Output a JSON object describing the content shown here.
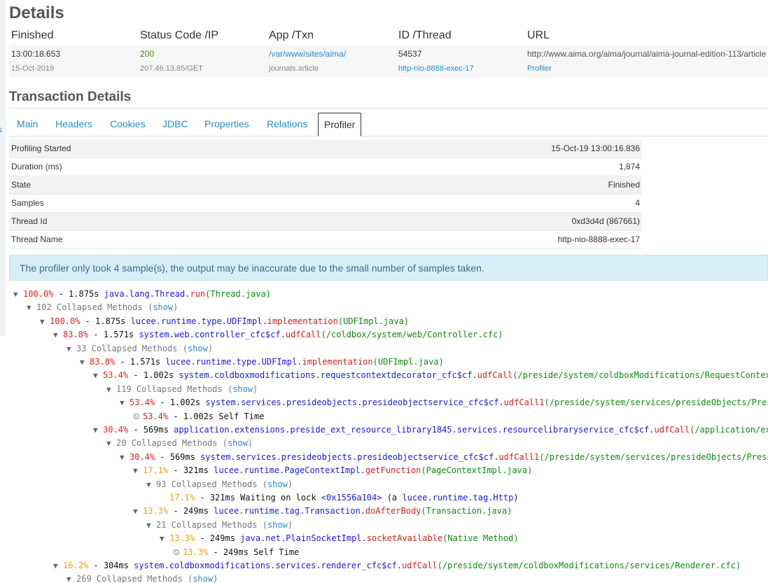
{
  "details": {
    "title": "Details",
    "headers": [
      "Finished",
      "Status Code /IP",
      "App /Txn",
      "ID /Thread",
      "URL"
    ],
    "finished_time": "13:00:18.653",
    "finished_date": "15-Oct-2019",
    "status_code": "200",
    "ip": "207.46.13.85/GET",
    "app": "/var/www/sites/aima/",
    "txn": "journals.article",
    "id": "54537",
    "thread": "http-nio-8888-exec-17",
    "url": "http://www.aima.org/aima/journal/aima-journal-edition-113/article",
    "url_sub": "Profiler"
  },
  "sidebar_fragment": "s",
  "transaction": {
    "title": "Transaction Details",
    "tabs": [
      "Main",
      "Headers",
      "Cookies",
      "JDBC",
      "Properties",
      "Relations",
      "Profiler"
    ],
    "active_tab": "Profiler"
  },
  "profile": {
    "rows": [
      {
        "label": "Profiling Started",
        "value": "15-Oct-19 13:00:16.836"
      },
      {
        "label": "Duration (ms)",
        "value": "1,874"
      },
      {
        "label": "State",
        "value": "Finished"
      },
      {
        "label": "Samples",
        "value": "4"
      },
      {
        "label": "Thread Id",
        "value": "0xd3d4d (867661)"
      },
      {
        "label": "Thread Name",
        "value": "http-nio-8888-exec-17"
      }
    ]
  },
  "alert": "The profiler only took 4 sample(s), the output may be inaccurate due to the small number of samples taken.",
  "tree": [
    {
      "t": "call",
      "d": 0,
      "pct": "100.0%",
      "time": "1.875s",
      "cls": "java.lang.Thread.",
      "method": "run",
      "src": "(Thread.java)"
    },
    {
      "t": "coll",
      "d": 1,
      "text": "102 Collapsed Methods",
      "show": "show"
    },
    {
      "t": "call",
      "d": 2,
      "pct": "100.0%",
      "time": "1.875s",
      "cls": "lucee.runtime.type.UDFImpl.",
      "method": "implementation",
      "src": "(UDFImpl.java)"
    },
    {
      "t": "call",
      "d": 3,
      "pct": "83.8%",
      "time": "1.571s",
      "cls": "system.web.controller_cfc$cf.",
      "method": "udfCall",
      "src": "(/coldbox/system/web/Controller.cfc)"
    },
    {
      "t": "coll",
      "d": 4,
      "text": "33 Collapsed Methods",
      "show": "show"
    },
    {
      "t": "call",
      "d": 5,
      "pct": "83.8%",
      "time": "1.571s",
      "cls": "lucee.runtime.type.UDFImpl.",
      "method": "implementation",
      "src": "(UDFImpl.java)"
    },
    {
      "t": "call",
      "d": 6,
      "pct": "53.4%",
      "time": "1.002s",
      "cls": "system.coldboxmodifications.requestcontextdecorator_cfc$cf.",
      "method": "udfCall",
      "src": "(/preside/system/coldboxModifications/RequestContextDecorator.cfc)"
    },
    {
      "t": "coll",
      "d": 7,
      "text": "119 Collapsed Methods",
      "show": "show"
    },
    {
      "t": "call",
      "d": 8,
      "pct": "53.4%",
      "time": "1.002s",
      "cls": "system.services.presideobjects.presideobjectservice_cfc$cf.",
      "method": "udfCall1",
      "src": "(/preside/system/services/presideObjects/PresideObjectService.cfc)"
    },
    {
      "t": "self",
      "d": 9,
      "pct": "53.4%",
      "time": "1.002s",
      "text": "Self Time"
    },
    {
      "t": "call",
      "d": 6,
      "pct": "30.4%",
      "time": "569ms",
      "cls": "application.extensions.preside_ext_resource_library1845.services.resourcelibraryservice_cfc$cf.",
      "method": "udfCall",
      "src": "(/application/extensions/preside-ext-resource-library/services/ResourceLibraryService.cfc)"
    },
    {
      "t": "coll",
      "d": 7,
      "text": "20 Collapsed Methods",
      "show": "show"
    },
    {
      "t": "call",
      "d": 8,
      "pct": "30.4%",
      "time": "569ms",
      "cls": "system.services.presideobjects.presideobjectservice_cfc$cf.",
      "method": "udfCall1",
      "src": "(/preside/system/services/presideObjects/PresideObjectService.cfc)"
    },
    {
      "t": "call",
      "d": 9,
      "pct": "17.1%",
      "time": "321ms",
      "cls": "lucee.runtime.PageContextImpl.",
      "method": "getFunction",
      "src": "(PageContextImpl.java)"
    },
    {
      "t": "coll",
      "d": 10,
      "text": "93 Collapsed Methods",
      "show": "show"
    },
    {
      "t": "lock",
      "d": 11,
      "pct": "17.1%",
      "time": "321ms",
      "pre": "Waiting on lock",
      "lock": "<0x1556a104>",
      "mid": "(a",
      "cls": "lucee.runtime.tag.Http",
      "post": ")"
    },
    {
      "t": "call",
      "d": 9,
      "pct": "13.3%",
      "time": "249ms",
      "cls": "lucee.runtime.tag.Transaction.",
      "method": "doAfterBody",
      "src": "(Transaction.java)"
    },
    {
      "t": "coll",
      "d": 10,
      "text": "21 Collapsed Methods",
      "show": "show"
    },
    {
      "t": "call",
      "d": 11,
      "pct": "13.3%",
      "time": "249ms",
      "cls": "java.net.PlainSocketImpl.",
      "method": "socketAvailable",
      "src": "(Native Method)"
    },
    {
      "t": "self",
      "d": 12,
      "pct": "13.3%",
      "time": "249ms",
      "text": "Self Time"
    },
    {
      "t": "call",
      "d": 3,
      "pct": "16.2%",
      "time": "304ms",
      "cls": "system.coldboxmodifications.services.renderer_cfc$cf.",
      "method": "udfCall",
      "src": "(/preside/system/coldboxModifications/services/Renderer.cfc)"
    },
    {
      "t": "coll",
      "d": 4,
      "text": "269 Collapsed Methods",
      "show": "show"
    }
  ],
  "colors": {
    "hot": "#e02020",
    "warm": "#f0a000",
    "class": "#1a1ad8",
    "source": "#108a10",
    "link": "#2a8cc4",
    "alert_bg": "#d9edf7"
  }
}
